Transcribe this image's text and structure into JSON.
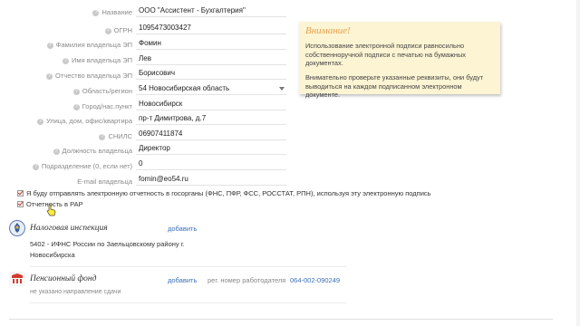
{
  "form": {
    "fields": [
      {
        "label": "Название",
        "value": "ООО \"Ассистент - Бухгалтерия\""
      },
      {
        "label": "ОГРН",
        "value": "1095473003427"
      },
      {
        "label": "Фамилия владельца ЭП",
        "value": "Фомин"
      },
      {
        "label": "Имя владельца ЭП",
        "value": "Лев"
      },
      {
        "label": "Отчество владельца ЭП",
        "value": "Борисович"
      },
      {
        "label": "Область/регион",
        "value": "54 Новосибирская область"
      },
      {
        "label": "Город/нас.пункт",
        "value": "Новосибирск"
      },
      {
        "label": "Улица, дом, офис/квартира",
        "value": "пр-т Димитрова, д.7"
      },
      {
        "label": "СНИЛС",
        "value": "06907411874"
      },
      {
        "label": "Должность владельца",
        "value": "Директор"
      },
      {
        "label": "Подразделение (0, если нет)",
        "value": "0"
      },
      {
        "label": "E-mail владельца",
        "value": "fomin@eo54.ru"
      }
    ]
  },
  "notice": {
    "title": "Внимание!",
    "para1": "Использование электронной подписи равносильно собственноручной подписи с печатью на бумажных документах.",
    "para2": "Внимательно проверьте указанные реквизиты, они будут выводиться на каждом подписанном электронном документе."
  },
  "checkboxes": {
    "gov_reporting": "Я буду отправлять электронную отчетность в госорганы (ФНС, ПФР, ФСС, РОССТАТ, РПН), используя эту электронную подпись",
    "rar_reporting": "Отчетность в РАР"
  },
  "tax": {
    "title": "Налоговая инспекция",
    "add": "добавить",
    "line1": "5402 - ИФНС России по Заельцовскому району г.",
    "line2": "Новосибирска"
  },
  "pension": {
    "title": "Пенсионный фонд",
    "add": "добавить",
    "reg_label": "рег. номер работодателя",
    "reg_value": "064-002-090249",
    "hint": "не указано направление сдачи"
  },
  "colors": {
    "accent_link": "#3a6fb5",
    "notice_bg": "#fcf4d3",
    "notice_title": "#e8a04a"
  }
}
